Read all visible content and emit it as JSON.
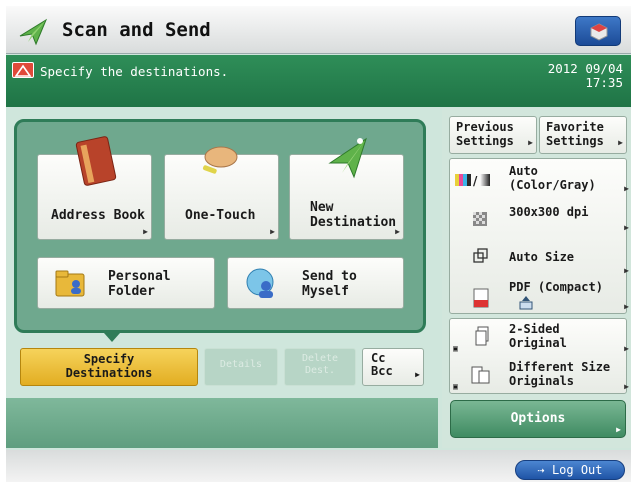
{
  "header": {
    "title": "Scan and Send",
    "app_icon": "paper-plane-icon",
    "device_icon": "device-status-icon"
  },
  "message": {
    "text": "Specify the destinations.",
    "date": "2012 09/04",
    "time": "17:35"
  },
  "destinations": {
    "address_book": "Address Book",
    "one_touch": "One-Touch",
    "new_destination_line1": "New",
    "new_destination_line2": "Destination",
    "personal_folder_line1": "Personal",
    "personal_folder_line2": "Folder",
    "send_to_myself_line1": "Send to",
    "send_to_myself_line2": "Myself"
  },
  "tabs": {
    "specify_line1": "Specify",
    "specify_line2": "Destinations",
    "details": "Details",
    "delete_line1": "Delete",
    "delete_line2": "Dest.",
    "cc": "Cc",
    "bcc": "Bcc"
  },
  "right": {
    "previous_line1": "Previous",
    "previous_line2": "Settings",
    "favorite_line1": "Favorite",
    "favorite_line2": "Settings",
    "color_line1": "Auto",
    "color_line2": "(Color/Gray)",
    "resolution": "300x300 dpi",
    "size": "Auto Size",
    "format": "PDF (Compact)",
    "sided_line1": "2-Sided",
    "sided_line2": "Original",
    "diffsize_line1": "Different Size",
    "diffsize_line2": "Originals",
    "options": "Options"
  },
  "footer": {
    "logout": "Log Out"
  },
  "colors": {
    "accent_green": "#1f7446",
    "active_tab": "#e2ad22",
    "logout_blue": "#1f54a6",
    "warning_red": "#e04a3a"
  }
}
